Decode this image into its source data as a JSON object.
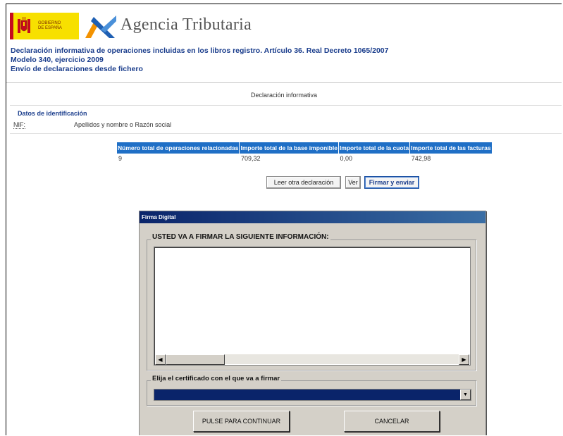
{
  "header": {
    "gov_logo_line1": "GOBIERNO",
    "gov_logo_line2": "DE ESPAÑA",
    "agency_name": "Agencia Tributaria"
  },
  "titles": {
    "line1": "Declaración informativa de operaciones incluidas en los libros registro. Artículo 36. Real Decreto 1065/2007",
    "line2": "Modelo 340, ejercicio 2009",
    "line3": "Envío de declaraciones desde fichero"
  },
  "declaration_title": "Declaración informativa",
  "identification": {
    "section_label": "Datos de identificación",
    "nif_label": "NIF:",
    "name_label": "Apellidos y nombre o Razón social"
  },
  "summary": {
    "headers": [
      "Número total de operaciones relacionadas",
      "Importe total de la base imponible",
      "Importe total de la cuota",
      "Importe total de las facturas"
    ],
    "values": [
      "9",
      "709,32",
      "0,00",
      "742,98"
    ]
  },
  "actions": {
    "read_other": "Leer otra declaración",
    "view": "Ver",
    "sign_send": "Firmar y enviar"
  },
  "dialog": {
    "title": "Firma Digital",
    "info_legend": "USTED VA A FIRMAR LA SIGUIENTE INFORMACIÓN:",
    "cert_legend": "Elija el certificado con el que va a firmar",
    "continue_button": "PULSE PARA CONTINUAR",
    "cancel_button": "CANCELAR"
  },
  "colors": {
    "title_blue": "#1a3d8c",
    "table_header": "#1f6fc6",
    "dialog_face": "#d4d0c8",
    "title_bar": "#0a246a",
    "logo_yellow": "#f7e000"
  }
}
